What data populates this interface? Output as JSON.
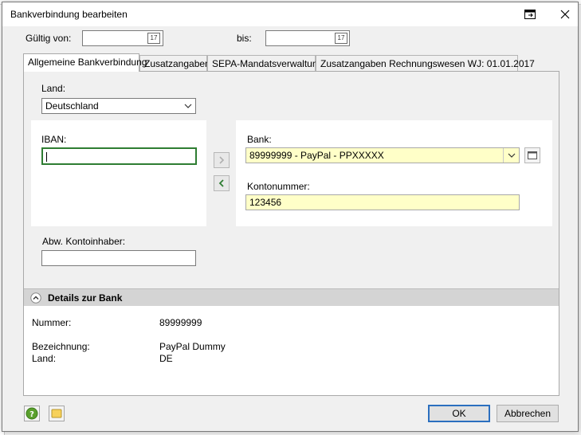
{
  "dialog": {
    "title": "Bankverbindung bearbeiten"
  },
  "validity": {
    "from_label": "Gültig von:",
    "from_value": "",
    "to_label": "bis:",
    "to_value": ""
  },
  "tabs": [
    {
      "label": "Allgemeine Bankverbindung",
      "active": true
    },
    {
      "label": "Zusatzangaben",
      "active": false
    },
    {
      "label": "SEPA-Mandatsverwaltung",
      "active": false
    },
    {
      "label": "Zusatzangaben Rechnungswesen WJ: 01.01.2017",
      "active": false
    }
  ],
  "form": {
    "land_label": "Land:",
    "land_value": "Deutschland",
    "iban_label": "IBAN:",
    "iban_value": "",
    "bank_label": "Bank:",
    "bank_value": "89999999 - PayPal - PPXXXXX",
    "konto_label": "Kontonummer:",
    "konto_value": "123456",
    "inhaber_label": "Abw. Kontoinhaber:",
    "inhaber_value": ""
  },
  "details": {
    "header": "Details zur Bank",
    "rows": [
      {
        "label": "Nummer:",
        "value": "89999999"
      },
      {
        "label": "Bezeichnung:",
        "value": "PayPal Dummy"
      },
      {
        "label": "Land:",
        "value": "DE"
      }
    ]
  },
  "buttons": {
    "ok": "OK",
    "cancel": "Abbrechen"
  },
  "colors": {
    "accent": "#2b6fbf",
    "focus": "#2e7d32",
    "highlight_field": "#ffffc8"
  }
}
